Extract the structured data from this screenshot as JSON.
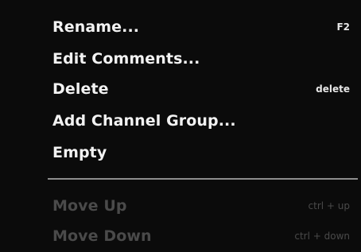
{
  "menu": {
    "items": [
      {
        "label": "Rename...",
        "shortcut": "F2"
      },
      {
        "label": "Edit Comments...",
        "shortcut": ""
      },
      {
        "label": "Delete",
        "shortcut": "delete"
      },
      {
        "label": "Add Channel Group...",
        "shortcut": ""
      },
      {
        "label": "Empty",
        "shortcut": ""
      }
    ],
    "disabled_items": [
      {
        "label": "Move Up",
        "shortcut": "ctrl + up"
      },
      {
        "label": "Move Down",
        "shortcut": "ctrl + down"
      }
    ]
  },
  "colors": {
    "background": "#0b0b0b",
    "text": "#f2f2f2",
    "disabled_text": "#4a4a4a",
    "separator": "#8d8d8d"
  }
}
